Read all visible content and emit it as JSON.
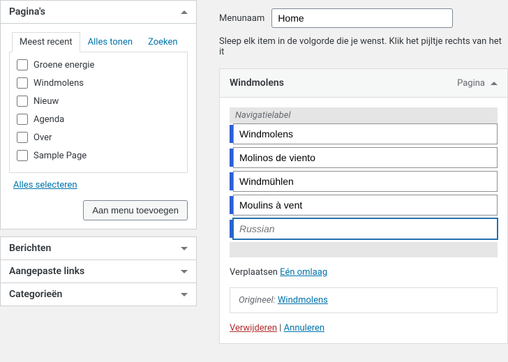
{
  "sidebar": {
    "pages": {
      "title": "Pagina's",
      "tabs": {
        "recent": "Meest recent",
        "all": "Alles tonen",
        "search": "Zoeken"
      },
      "items": [
        {
          "label": "Groene energie"
        },
        {
          "label": "Windmolens"
        },
        {
          "label": "Nieuw"
        },
        {
          "label": "Agenda"
        },
        {
          "label": "Over"
        },
        {
          "label": "Sample Page"
        }
      ],
      "select_all": "Alles selecteren",
      "add_button": "Aan menu toevoegen"
    },
    "closed_boxes": {
      "posts": "Berichten",
      "custom_links": "Aangepaste links",
      "categories": "Categorieën"
    }
  },
  "main": {
    "menu_name_label": "Menunaam",
    "menu_name_value": "Home",
    "instruction": "Sleep elk item in de volgorde die je wenst. Klik het pijltje rechts van het it",
    "item": {
      "title": "Windmolens",
      "type": "Pagina",
      "nav_label_title": "Navigatielabel",
      "translations": [
        {
          "value": "Windmolens"
        },
        {
          "value": "Molinos de viento"
        },
        {
          "value": "Windmühlen"
        },
        {
          "value": "Moulins à vent"
        }
      ],
      "russian_placeholder": "Russian",
      "move_label": "Verplaatsen",
      "move_down": "Eén omlaag",
      "origin_label": "Origineel:",
      "origin_link": "Windmolens",
      "delete": "Verwijderen",
      "cancel": "Annuleren"
    }
  }
}
